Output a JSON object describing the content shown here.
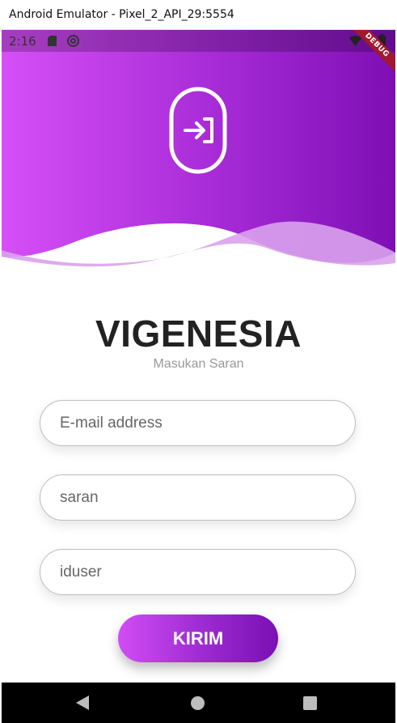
{
  "window": {
    "title": "Android Emulator - Pixel_2_API_29:5554"
  },
  "status_bar": {
    "time": "2:16",
    "icons": [
      "sd-card-icon",
      "sync-icon",
      "wifi-icon",
      "battery-icon"
    ]
  },
  "debug_banner": "DEBUG",
  "header": {
    "icon": "login-icon",
    "gradient_colors": [
      "#d64ff7",
      "#9a22cf",
      "#7e0fb5"
    ]
  },
  "app": {
    "title": "VIGENESIA",
    "subtitle": "Masukan Saran"
  },
  "form": {
    "email_placeholder": "E-mail address",
    "saran_placeholder": "saran",
    "iduser_placeholder": "iduser",
    "submit_label": "KIRIM"
  },
  "nav_bar": {
    "buttons": [
      "back-icon",
      "home-icon",
      "recents-icon"
    ]
  }
}
